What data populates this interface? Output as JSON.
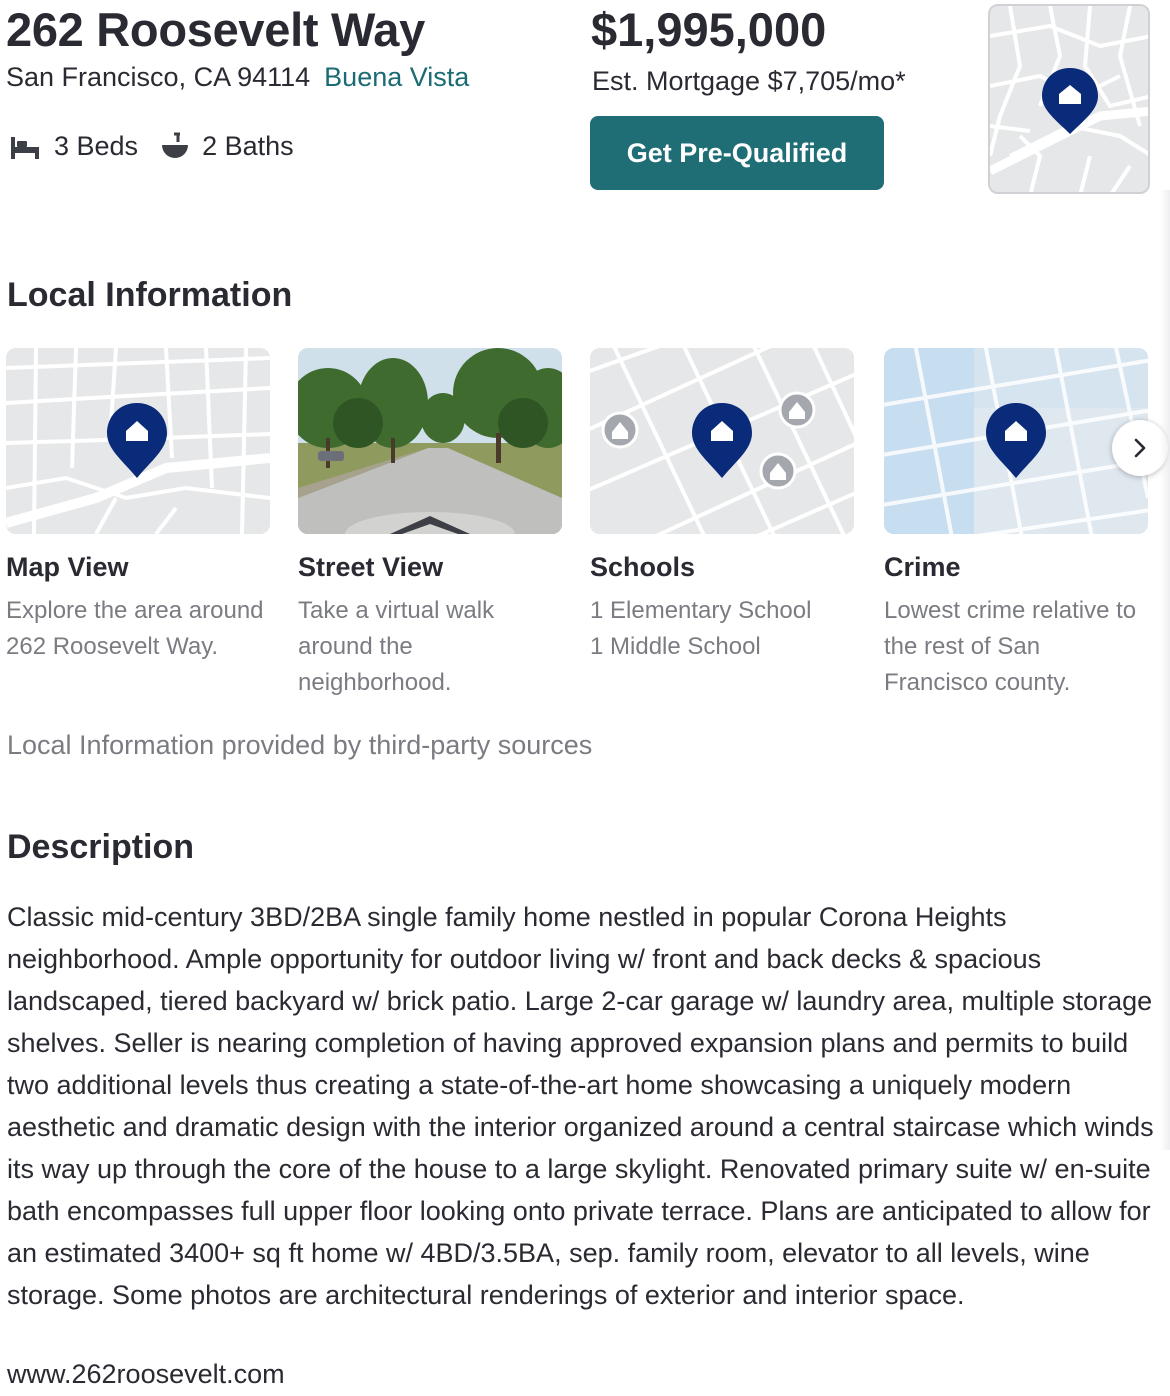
{
  "listing": {
    "address": "262 Roosevelt Way",
    "city_line": "San Francisco, CA 94114",
    "neighborhood": "Buena Vista",
    "beds": "3 Beds",
    "baths": "2 Baths",
    "price": "$1,995,000",
    "mortgage": "Est. Mortgage $7,705/mo*",
    "cta": "Get Pre-Qualified"
  },
  "local_info": {
    "title": "Local Information",
    "cards": [
      {
        "title": "Map View",
        "desc": "Explore the area around 262 Roosevelt Way."
      },
      {
        "title": "Street View",
        "desc": "Take a virtual walk around the neighborhood."
      },
      {
        "title": "Schools",
        "desc": "1 Elementary School 1 Middle School",
        "lines": [
          "1 Elementary School",
          "1 Middle School"
        ]
      },
      {
        "title": "Crime",
        "desc": "Lowest crime relative to the rest of San Francisco county."
      }
    ],
    "sources": "Local Information provided by third-party sources"
  },
  "description": {
    "title": "Description",
    "body": "Classic mid-century 3BD/2BA single family home nestled in popular Corona Heights neighborhood. Ample opportunity for outdoor living w/ front and back decks & spacious landscaped, tiered backyard w/ brick patio. Large 2-car garage w/ laundry area, multiple storage shelves. Seller is nearing completion of having approved expansion plans and permits to build two additional levels thus creating a state-of-the-art home showcasing a uniquely modern aesthetic and dramatic design with the interior organized around a central staircase which winds its way up through the core of the house to a large skylight. Renovated primary suite w/ en-suite bath encompasses full upper floor looking onto private terrace. Plans are anticipated to allow for an estimated 3400+ sq ft home w/ 4BD/3.5BA, sep. family room, elevator to all levels, wine storage. Some photos are architectural renderings of exterior and interior space.",
    "website": "www.262roosevelt.com"
  },
  "colors": {
    "brand_teal": "#1f6e76",
    "link_teal": "#1b6b73",
    "pin_navy": "#0a2a7a",
    "muted_text": "#7a7c82",
    "crime_tint": "#c7ddf0"
  },
  "icons": [
    "bed-icon",
    "bath-icon",
    "location-pin-icon",
    "school-icon",
    "chevron-right-icon",
    "street-view-arrow-icon"
  ]
}
